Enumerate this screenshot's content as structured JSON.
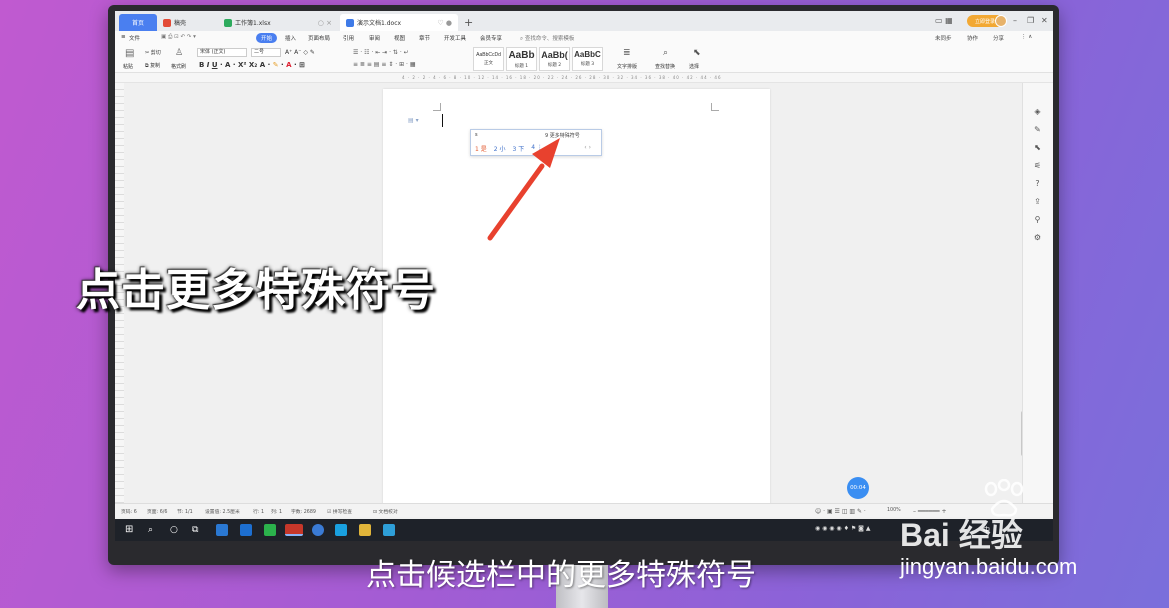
{
  "overlay": {
    "caption_big": "点击更多特殊符号",
    "subtitle": "点击候选栏中的更多特殊符号",
    "watermark_brand": "Bai 经验",
    "watermark_url": "jingyan.baidu.com"
  },
  "tabs": [
    {
      "label": "首页"
    },
    {
      "label": "稿壳"
    },
    {
      "label": "工作簿1.xlsx"
    },
    {
      "label": "演示文档1.docx"
    }
  ],
  "window": {
    "login_label": "立即登录",
    "add_tab": "+"
  },
  "menu": {
    "file": "文件",
    "items": [
      "开始",
      "插入",
      "页面布局",
      "引用",
      "审阅",
      "视图",
      "章节",
      "开发工具",
      "会员专享"
    ],
    "search": "查找命令、搜索模板",
    "right": [
      "未同步",
      "协作",
      "分享"
    ]
  },
  "toolbar": {
    "paste": "粘贴",
    "cut": "剪切",
    "copy": "复制",
    "format_painter": "格式刷",
    "font_name": "宋体 (正文)",
    "font_size": "二号",
    "styles": [
      {
        "preview": "AaBbCcDd",
        "name": "正文"
      },
      {
        "preview": "AaBb",
        "name": "标题 1"
      },
      {
        "preview": "AaBb(",
        "name": "标题 2"
      },
      {
        "preview": "AaBbC",
        "name": "标题 3"
      }
    ],
    "text_layout": "文字排版",
    "find_replace": "查找替换",
    "select": "选择"
  },
  "ruler": {
    "numbers": "4 · 2 · 2 · 4 · 6 · 8 · 10 · 12 · 14 · 16 · 18 · 20 · 22 · 24 · 26 · 28 · 30 · 32 · 34 · 36 · 38 · 40 · 42 · 44 · 46"
  },
  "ime": {
    "input": "s",
    "more_symbols": "9 更多特殊符号",
    "candidates": [
      "1 是",
      "2 小",
      "3 下",
      "4 ⋮"
    ],
    "nav": "‹   ›"
  },
  "status": {
    "page_num": "页码: 6",
    "pages": "页面: 6/6",
    "section": "节: 1/1",
    "setting": "设置值: 2.5厘米",
    "row": "行: 1",
    "col": "列: 1",
    "words": "字数: 2689",
    "spell": "拼写检查",
    "proof": "文档校对",
    "zoom": "100%",
    "ime_lang": "中"
  },
  "timer": "00:04",
  "colors": {
    "accent": "#4a7ff0",
    "arrow": "#e8412e",
    "taskbar": "#1e2229"
  }
}
